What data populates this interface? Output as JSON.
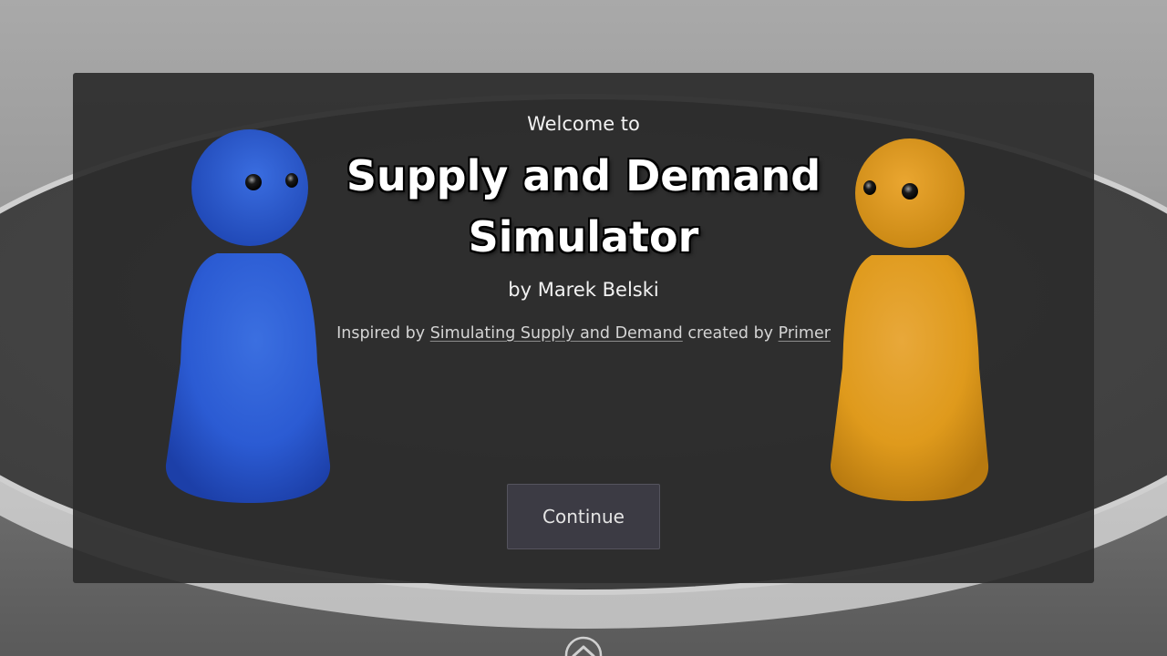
{
  "welcome_screen": {
    "welcome_text": "Welcome to",
    "title_line1": "Supply and Demand",
    "title_line2": "Simulator",
    "author_text": "by Marek Belski",
    "inspired": {
      "prefix": "Inspired by ",
      "video_link": "Simulating Supply and Demand",
      "middle": " created by ",
      "creator_link": "Primer"
    },
    "continue_label": "Continue"
  },
  "figures": [
    {
      "name": "blue-blob-character",
      "color": "#2f5fd6"
    },
    {
      "name": "orange-blob-character",
      "color": "#e39c1d"
    }
  ],
  "icons": {
    "expand_toggle": "chevron-up-circle-icon"
  },
  "colors": {
    "panel_background": "#2c2c2c",
    "button_background": "#3c3b44",
    "blue_figure": "#2f5fd6",
    "orange_figure": "#e39c1d"
  }
}
